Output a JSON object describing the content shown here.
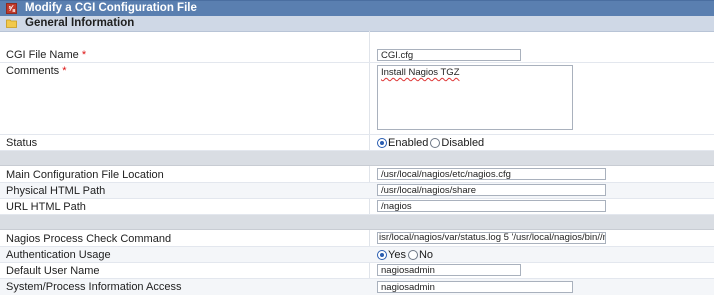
{
  "title_bar": {
    "title": "Modify a CGI Configuration File",
    "icon": "config-file-icon"
  },
  "section": {
    "title": "General Information",
    "icon": "folder-icon"
  },
  "fields": {
    "cgi_file_name": {
      "label": "CGI File Name",
      "required": "*",
      "value": "CGI.cfg"
    },
    "comments": {
      "label": "Comments",
      "required": "*",
      "value": "Install Nagios TGZ"
    },
    "status": {
      "label": "Status",
      "options": [
        "Enabled",
        "Disabled"
      ],
      "selected": "Enabled"
    },
    "main_config": {
      "label": "Main Configuration File Location",
      "value": "/usr/local/nagios/etc/nagios.cfg"
    },
    "physical_html": {
      "label": "Physical HTML Path",
      "value": "/usr/local/nagios/share"
    },
    "url_html": {
      "label": "URL HTML Path",
      "value": "/nagios"
    },
    "process_check": {
      "label": "Nagios Process Check Command",
      "value": "isr/local/nagios/var/status.log 5 '/usr/local/nagios/bin//nagios'"
    },
    "auth_usage": {
      "label": "Authentication Usage",
      "options": [
        "Yes",
        "No"
      ],
      "selected": "Yes"
    },
    "default_user": {
      "label": "Default User Name",
      "value": "nagiosadmin"
    },
    "sys_info": {
      "label": "System/Process Information Access",
      "value": "nagiosadmin"
    }
  },
  "colors": {
    "title_bar": "#5a7fb0",
    "section_header": "#cfd8e6",
    "separator": "#d9dde3",
    "required": "#dd1111",
    "radio_selected": "#2a5db0"
  }
}
